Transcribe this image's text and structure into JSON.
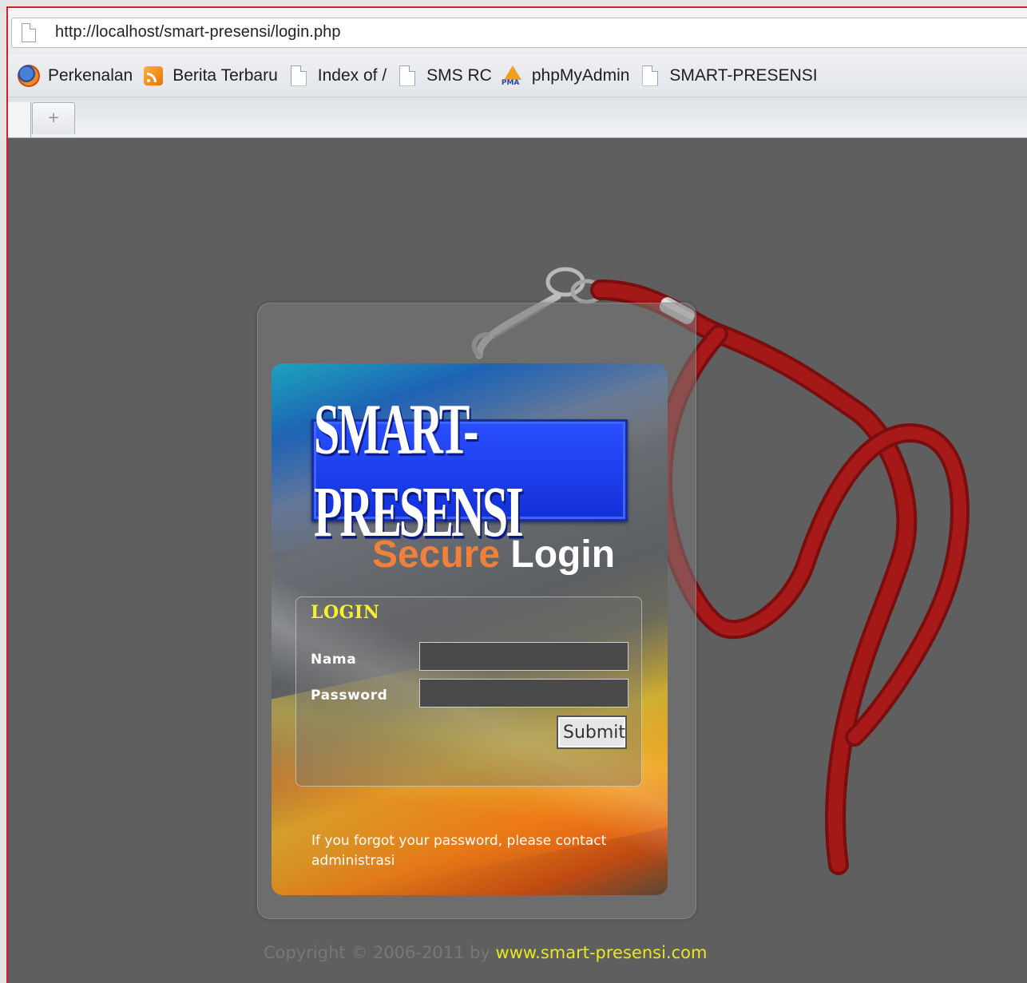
{
  "browser": {
    "url": "http://localhost/smart-presensi/login.php",
    "bookmarks": [
      {
        "label": "Perkenalan",
        "icon": "firefox-icon"
      },
      {
        "label": "Berita Terbaru",
        "icon": "rss-icon"
      },
      {
        "label": "Index of /",
        "icon": "page-icon"
      },
      {
        "label": "SMS RC",
        "icon": "page-icon"
      },
      {
        "label": "phpMyAdmin",
        "icon": "phpmyadmin-icon"
      },
      {
        "label": "SMART-PRESENSI",
        "icon": "page-icon"
      }
    ],
    "new_tab_label": "+"
  },
  "card": {
    "logo_text": "SMART-PRESENSI",
    "headline_part1": "Secure",
    "headline_part2": "Login",
    "panel_title": "LOGIN",
    "nama_label": "Nama",
    "nama_value": "",
    "password_label": "Password",
    "password_value": "",
    "submit_label": "Submit",
    "forgot_text": "If you forgot your password, please contact administrasi"
  },
  "footer": {
    "copyright_text": "Copyright © 2006-2011 by ",
    "link_text": "www.smart-presensi.com"
  },
  "colors": {
    "page_background": "#5f5f5f",
    "headline_accent": "#f0803a",
    "panel_title": "#f7f030",
    "footer_link": "#e8e820",
    "logo_blue": "#1e40ee",
    "lanyard_red": "#9a1414"
  }
}
